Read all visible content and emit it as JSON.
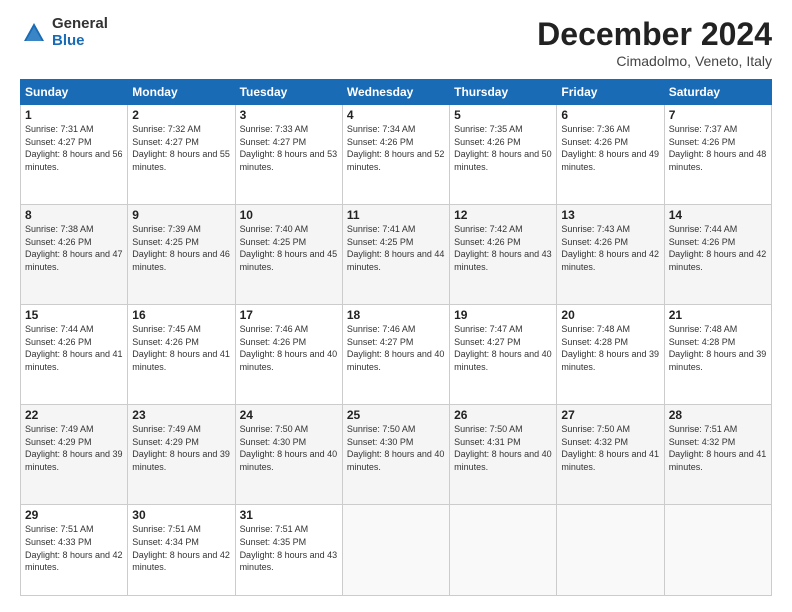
{
  "header": {
    "logo_general": "General",
    "logo_blue": "Blue",
    "month_title": "December 2024",
    "location": "Cimadolmo, Veneto, Italy"
  },
  "weekdays": [
    "Sunday",
    "Monday",
    "Tuesday",
    "Wednesday",
    "Thursday",
    "Friday",
    "Saturday"
  ],
  "weeks": [
    [
      {
        "day": "1",
        "sunrise": "Sunrise: 7:31 AM",
        "sunset": "Sunset: 4:27 PM",
        "daylight": "Daylight: 8 hours and 56 minutes."
      },
      {
        "day": "2",
        "sunrise": "Sunrise: 7:32 AM",
        "sunset": "Sunset: 4:27 PM",
        "daylight": "Daylight: 8 hours and 55 minutes."
      },
      {
        "day": "3",
        "sunrise": "Sunrise: 7:33 AM",
        "sunset": "Sunset: 4:27 PM",
        "daylight": "Daylight: 8 hours and 53 minutes."
      },
      {
        "day": "4",
        "sunrise": "Sunrise: 7:34 AM",
        "sunset": "Sunset: 4:26 PM",
        "daylight": "Daylight: 8 hours and 52 minutes."
      },
      {
        "day": "5",
        "sunrise": "Sunrise: 7:35 AM",
        "sunset": "Sunset: 4:26 PM",
        "daylight": "Daylight: 8 hours and 50 minutes."
      },
      {
        "day": "6",
        "sunrise": "Sunrise: 7:36 AM",
        "sunset": "Sunset: 4:26 PM",
        "daylight": "Daylight: 8 hours and 49 minutes."
      },
      {
        "day": "7",
        "sunrise": "Sunrise: 7:37 AM",
        "sunset": "Sunset: 4:26 PM",
        "daylight": "Daylight: 8 hours and 48 minutes."
      }
    ],
    [
      {
        "day": "8",
        "sunrise": "Sunrise: 7:38 AM",
        "sunset": "Sunset: 4:26 PM",
        "daylight": "Daylight: 8 hours and 47 minutes."
      },
      {
        "day": "9",
        "sunrise": "Sunrise: 7:39 AM",
        "sunset": "Sunset: 4:25 PM",
        "daylight": "Daylight: 8 hours and 46 minutes."
      },
      {
        "day": "10",
        "sunrise": "Sunrise: 7:40 AM",
        "sunset": "Sunset: 4:25 PM",
        "daylight": "Daylight: 8 hours and 45 minutes."
      },
      {
        "day": "11",
        "sunrise": "Sunrise: 7:41 AM",
        "sunset": "Sunset: 4:25 PM",
        "daylight": "Daylight: 8 hours and 44 minutes."
      },
      {
        "day": "12",
        "sunrise": "Sunrise: 7:42 AM",
        "sunset": "Sunset: 4:26 PM",
        "daylight": "Daylight: 8 hours and 43 minutes."
      },
      {
        "day": "13",
        "sunrise": "Sunrise: 7:43 AM",
        "sunset": "Sunset: 4:26 PM",
        "daylight": "Daylight: 8 hours and 42 minutes."
      },
      {
        "day": "14",
        "sunrise": "Sunrise: 7:44 AM",
        "sunset": "Sunset: 4:26 PM",
        "daylight": "Daylight: 8 hours and 42 minutes."
      }
    ],
    [
      {
        "day": "15",
        "sunrise": "Sunrise: 7:44 AM",
        "sunset": "Sunset: 4:26 PM",
        "daylight": "Daylight: 8 hours and 41 minutes."
      },
      {
        "day": "16",
        "sunrise": "Sunrise: 7:45 AM",
        "sunset": "Sunset: 4:26 PM",
        "daylight": "Daylight: 8 hours and 41 minutes."
      },
      {
        "day": "17",
        "sunrise": "Sunrise: 7:46 AM",
        "sunset": "Sunset: 4:26 PM",
        "daylight": "Daylight: 8 hours and 40 minutes."
      },
      {
        "day": "18",
        "sunrise": "Sunrise: 7:46 AM",
        "sunset": "Sunset: 4:27 PM",
        "daylight": "Daylight: 8 hours and 40 minutes."
      },
      {
        "day": "19",
        "sunrise": "Sunrise: 7:47 AM",
        "sunset": "Sunset: 4:27 PM",
        "daylight": "Daylight: 8 hours and 40 minutes."
      },
      {
        "day": "20",
        "sunrise": "Sunrise: 7:48 AM",
        "sunset": "Sunset: 4:28 PM",
        "daylight": "Daylight: 8 hours and 39 minutes."
      },
      {
        "day": "21",
        "sunrise": "Sunrise: 7:48 AM",
        "sunset": "Sunset: 4:28 PM",
        "daylight": "Daylight: 8 hours and 39 minutes."
      }
    ],
    [
      {
        "day": "22",
        "sunrise": "Sunrise: 7:49 AM",
        "sunset": "Sunset: 4:29 PM",
        "daylight": "Daylight: 8 hours and 39 minutes."
      },
      {
        "day": "23",
        "sunrise": "Sunrise: 7:49 AM",
        "sunset": "Sunset: 4:29 PM",
        "daylight": "Daylight: 8 hours and 39 minutes."
      },
      {
        "day": "24",
        "sunrise": "Sunrise: 7:50 AM",
        "sunset": "Sunset: 4:30 PM",
        "daylight": "Daylight: 8 hours and 40 minutes."
      },
      {
        "day": "25",
        "sunrise": "Sunrise: 7:50 AM",
        "sunset": "Sunset: 4:30 PM",
        "daylight": "Daylight: 8 hours and 40 minutes."
      },
      {
        "day": "26",
        "sunrise": "Sunrise: 7:50 AM",
        "sunset": "Sunset: 4:31 PM",
        "daylight": "Daylight: 8 hours and 40 minutes."
      },
      {
        "day": "27",
        "sunrise": "Sunrise: 7:50 AM",
        "sunset": "Sunset: 4:32 PM",
        "daylight": "Daylight: 8 hours and 41 minutes."
      },
      {
        "day": "28",
        "sunrise": "Sunrise: 7:51 AM",
        "sunset": "Sunset: 4:32 PM",
        "daylight": "Daylight: 8 hours and 41 minutes."
      }
    ],
    [
      {
        "day": "29",
        "sunrise": "Sunrise: 7:51 AM",
        "sunset": "Sunset: 4:33 PM",
        "daylight": "Daylight: 8 hours and 42 minutes."
      },
      {
        "day": "30",
        "sunrise": "Sunrise: 7:51 AM",
        "sunset": "Sunset: 4:34 PM",
        "daylight": "Daylight: 8 hours and 42 minutes."
      },
      {
        "day": "31",
        "sunrise": "Sunrise: 7:51 AM",
        "sunset": "Sunset: 4:35 PM",
        "daylight": "Daylight: 8 hours and 43 minutes."
      },
      null,
      null,
      null,
      null
    ]
  ]
}
